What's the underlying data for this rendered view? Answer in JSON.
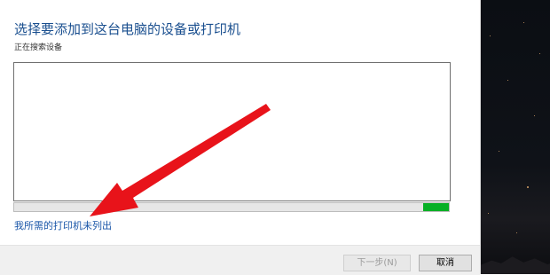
{
  "dialog": {
    "title": "选择要添加到这台电脑的设备或打印机",
    "status": "正在搜索设备",
    "progress": 0.06,
    "printer_not_listed_link": "我所需的打印机未列出",
    "buttons": {
      "next": "下一步(N)",
      "cancel": "取消"
    }
  },
  "colors": {
    "title": "#1a4f8f",
    "link": "#1a56a8",
    "progress_fill": "#06b025",
    "arrow": "#e8131a"
  }
}
